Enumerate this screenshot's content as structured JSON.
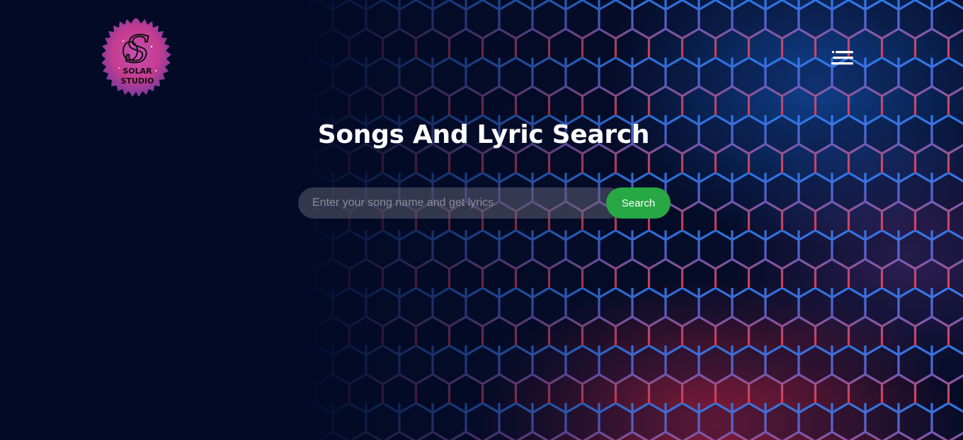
{
  "header": {
    "logo": {
      "monogram": "S",
      "text_line_1": "SOLAR",
      "text_line_2": "STUDIO"
    },
    "menu_icon": "hamburger-menu-icon"
  },
  "hero": {
    "title": "Songs And Lyric Search"
  },
  "search": {
    "placeholder": "Enter your song name and get lyrics",
    "value": "",
    "button_label": "Search"
  },
  "colors": {
    "background": "#020a24",
    "search_button": "#28a745",
    "glow_blue": "#1e6ee6",
    "glow_red": "#dc2846",
    "logo_pink": "#d63a8f"
  }
}
